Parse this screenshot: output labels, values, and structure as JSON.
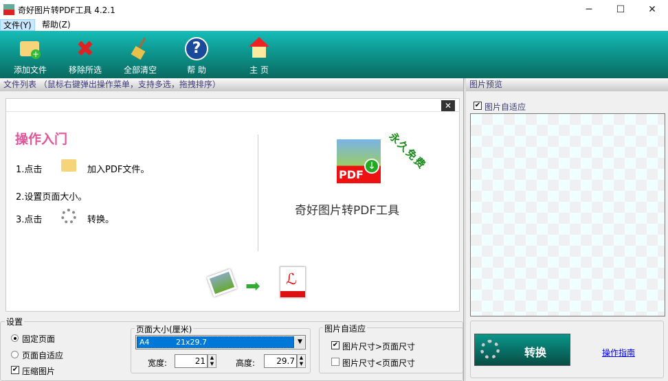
{
  "window": {
    "title": "奇好图片转PDF工具 4.2.1",
    "minimize": "─",
    "maximize": "☐",
    "close": "✕"
  },
  "menu": [
    {
      "label": "文件(Y)"
    },
    {
      "label": "帮助(Z)"
    }
  ],
  "toolbar": [
    {
      "label": "添加文件",
      "icon": "folder-add-icon"
    },
    {
      "label": "移除所选",
      "icon": "remove-x-icon"
    },
    {
      "label": "全部清空",
      "icon": "broom-icon"
    },
    {
      "label": "帮 助",
      "icon": "help-icon"
    },
    {
      "label": "主 页",
      "icon": "home-icon"
    }
  ],
  "file_list": {
    "header": "文件列表  （鼠标右键弹出操作菜单，支持多选，拖拽排序）",
    "close": "✕"
  },
  "welcome": {
    "title": "操作入门",
    "step1a": "1.点击",
    "step1b": "加入PDF文件。",
    "step2": "2.设置页面大小。",
    "step3a": "3.点击",
    "step3b": "转换。",
    "badge": "永久免费",
    "product": "奇好图片转PDF工具",
    "pdf_label": "PDF"
  },
  "preview": {
    "header": "图片预览",
    "fit_label": "图片自适应",
    "fit_checked": true
  },
  "settings": {
    "legend": "设置",
    "fixed_page": "固定页面",
    "fit_page": "页面自适应",
    "compress": "压缩图片",
    "fixed_selected": true,
    "compress_checked": true
  },
  "page_size": {
    "legend": "页面大小(厘米)",
    "selected_name": "A4",
    "selected_size": "21x29.7",
    "width_label": "宽度:",
    "width": "21",
    "height_label": "高度:",
    "height": "29.7"
  },
  "image_fit": {
    "legend": "图片自适应",
    "opt1": "图片尺寸>页面尺寸",
    "opt2": "图片尺寸<页面尺寸",
    "opt1_checked": true,
    "opt2_checked": false
  },
  "actions": {
    "convert": "转换",
    "guide": "操作指南"
  }
}
